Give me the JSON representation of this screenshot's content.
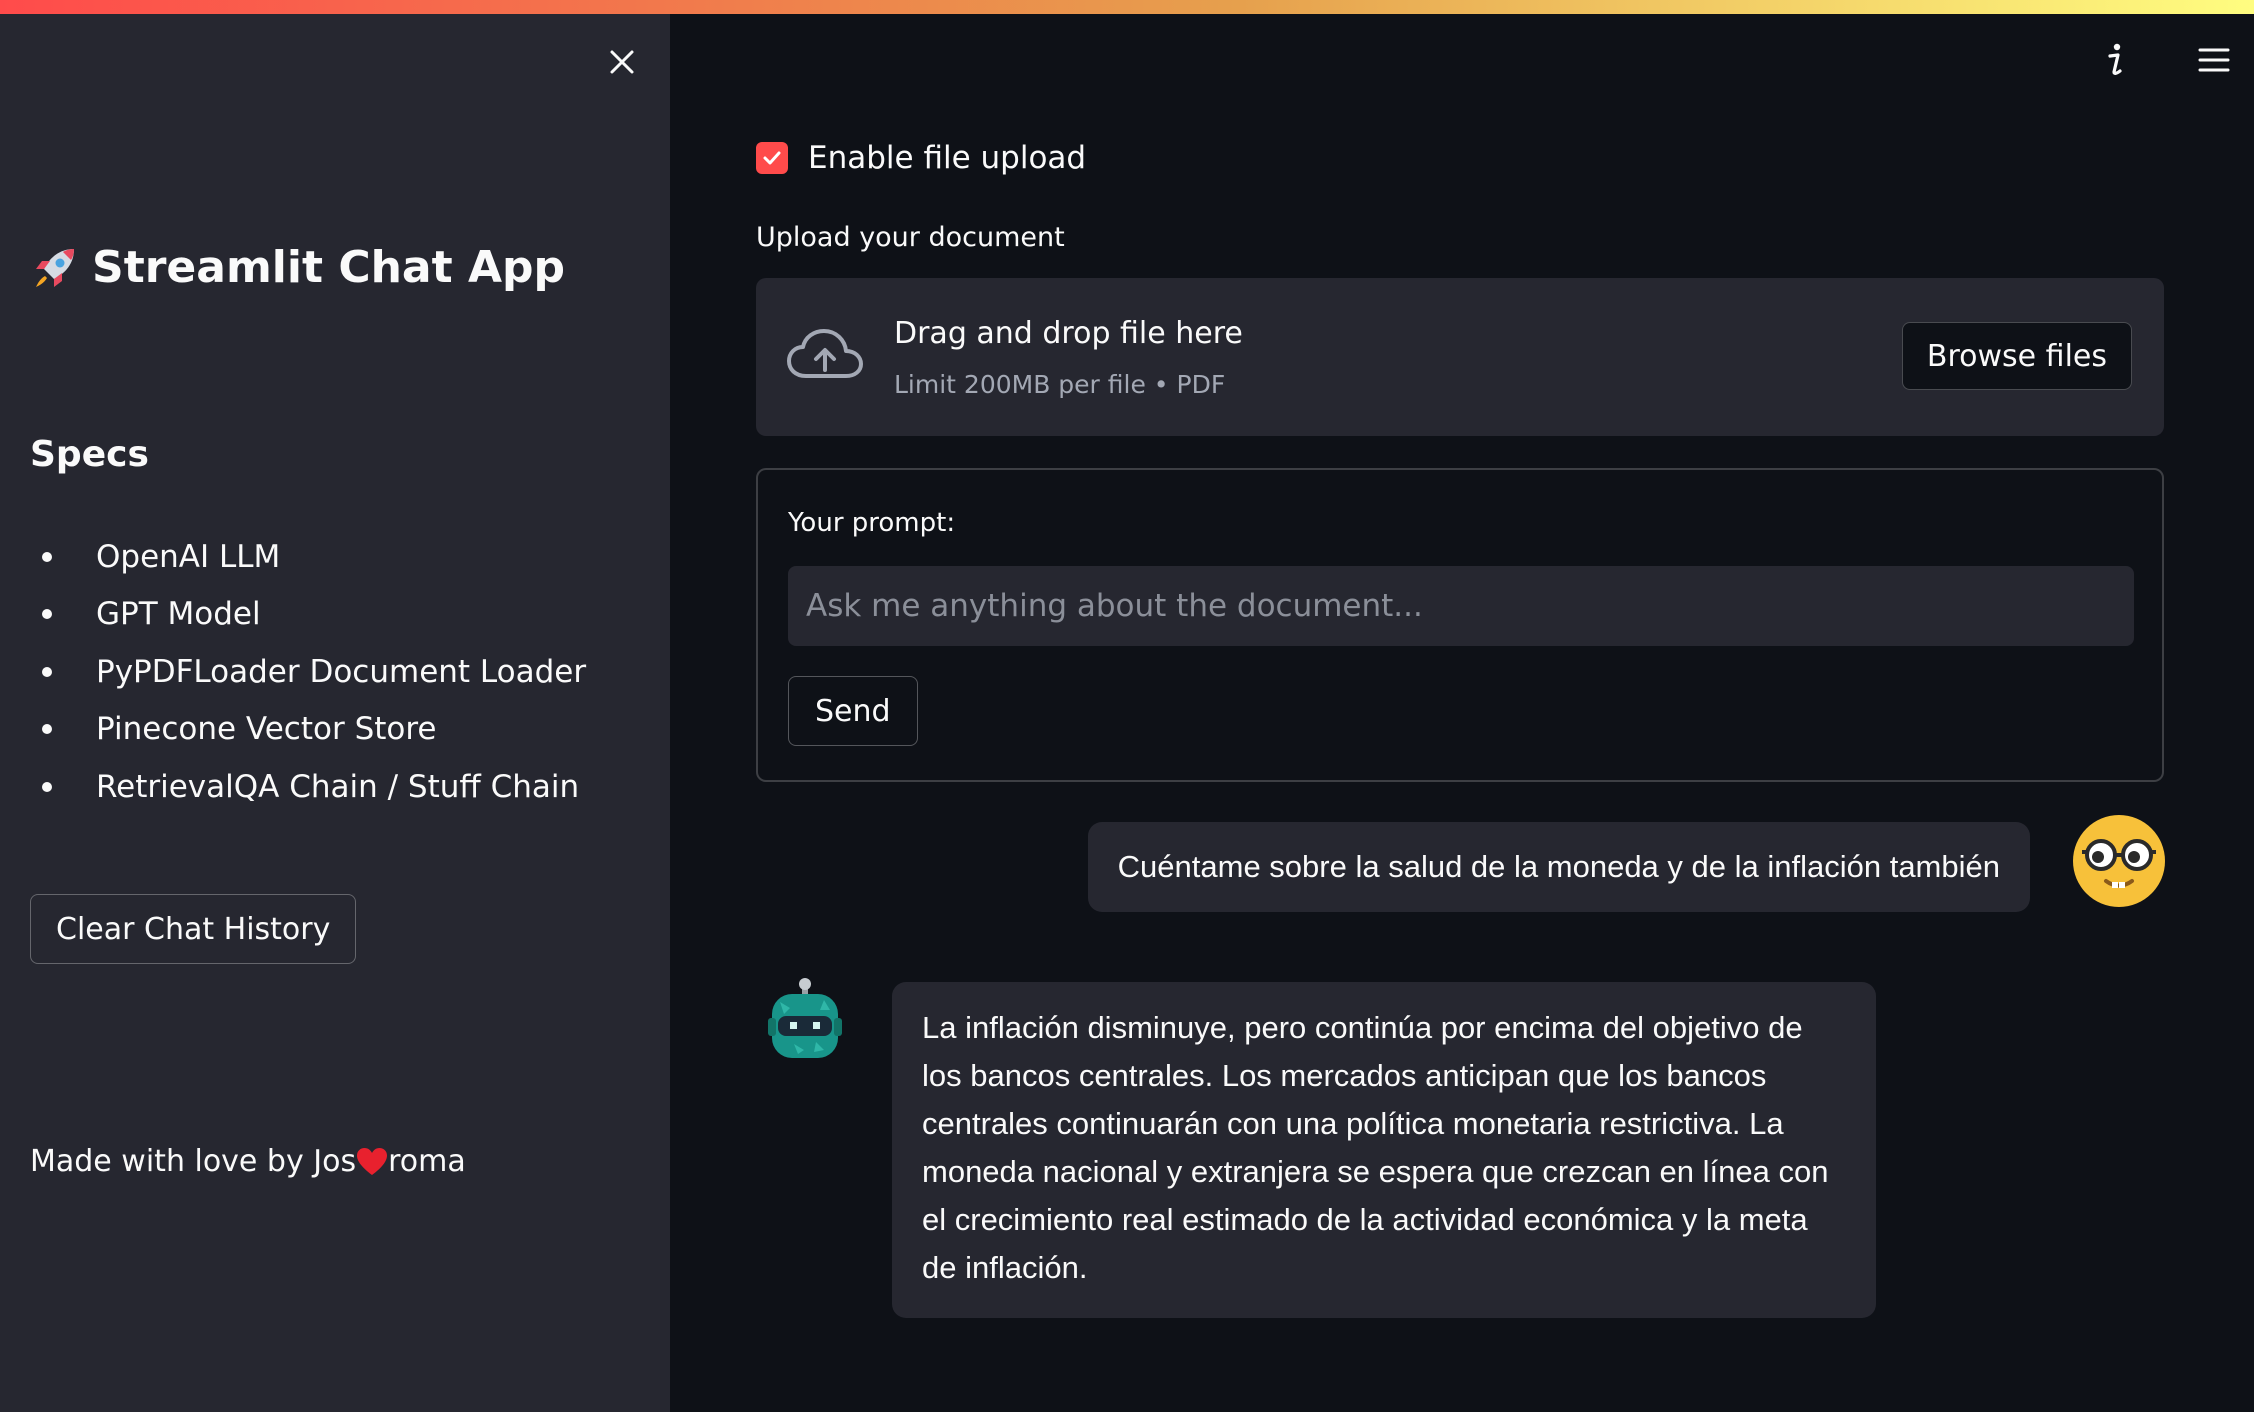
{
  "sidebar": {
    "title": "Streamlit Chat App",
    "title_icon": "rocket-emoji",
    "specs_heading": "Specs",
    "specs_items": [
      "OpenAI LLM",
      "GPT Model",
      "PyPDFLoader Document Loader",
      "Pinecone Vector Store",
      "RetrievalQA Chain / Stuff Chain"
    ],
    "clear_button": "Clear Chat History",
    "footer_before": "Made with love by Jos",
    "footer_after": "roma",
    "footer_icon": "heart-icon"
  },
  "header": {
    "icons": [
      "info-icon",
      "hamburger-menu-icon"
    ]
  },
  "main": {
    "checkbox_label": "Enable file upload",
    "checkbox_checked": true,
    "upload_label": "Upload your document",
    "dropzone_title": "Drag and drop file here",
    "dropzone_hint": "Limit 200MB per file • PDF",
    "browse_button": "Browse files",
    "prompt_label": "Your prompt:",
    "prompt_placeholder": "Ask me anything about the document...",
    "prompt_value": "",
    "send_button": "Send"
  },
  "chat": {
    "user_message": "Cuéntame sobre la salud de la moneda y de la inflación también",
    "bot_message": "La inflación disminuye, pero continúa por encima del objetivo de los bancos centrales. Los mercados anticipan que los bancos centrales continuarán con una política monetaria restrictiva. La moneda nacional y extranjera se espera que crezcan en línea con el crecimiento real estimado de la actividad económica y la meta de inflación."
  },
  "colors": {
    "background": "#0e1117",
    "sidebar": "#262730",
    "accent": "#ff4b4b",
    "text": "#fafafa"
  }
}
